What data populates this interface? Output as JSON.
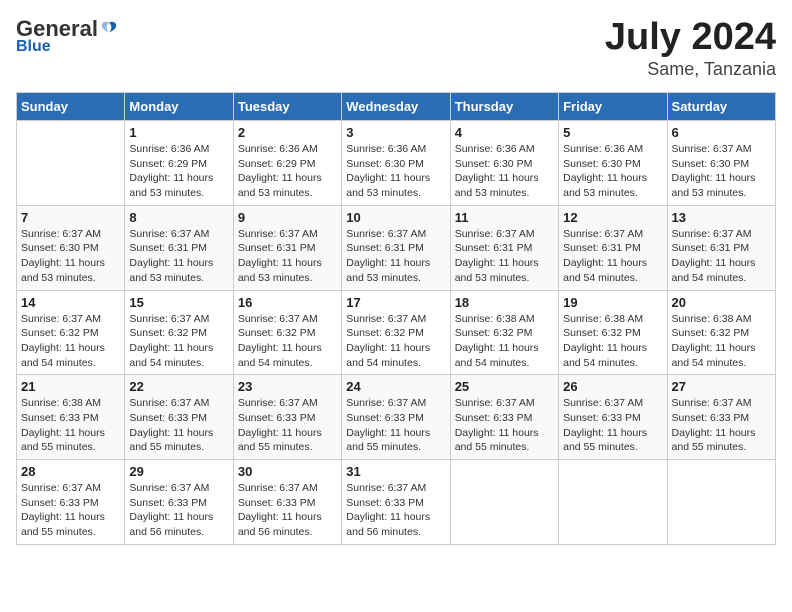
{
  "header": {
    "logo_general": "General",
    "logo_blue": "Blue",
    "title": "July 2024",
    "location": "Same, Tanzania"
  },
  "days_of_week": [
    "Sunday",
    "Monday",
    "Tuesday",
    "Wednesday",
    "Thursday",
    "Friday",
    "Saturday"
  ],
  "weeks": [
    [
      {
        "day": "",
        "sunrise": "",
        "sunset": "",
        "daylight": ""
      },
      {
        "day": "1",
        "sunrise": "Sunrise: 6:36 AM",
        "sunset": "Sunset: 6:29 PM",
        "daylight": "Daylight: 11 hours and 53 minutes."
      },
      {
        "day": "2",
        "sunrise": "Sunrise: 6:36 AM",
        "sunset": "Sunset: 6:29 PM",
        "daylight": "Daylight: 11 hours and 53 minutes."
      },
      {
        "day": "3",
        "sunrise": "Sunrise: 6:36 AM",
        "sunset": "Sunset: 6:30 PM",
        "daylight": "Daylight: 11 hours and 53 minutes."
      },
      {
        "day": "4",
        "sunrise": "Sunrise: 6:36 AM",
        "sunset": "Sunset: 6:30 PM",
        "daylight": "Daylight: 11 hours and 53 minutes."
      },
      {
        "day": "5",
        "sunrise": "Sunrise: 6:36 AM",
        "sunset": "Sunset: 6:30 PM",
        "daylight": "Daylight: 11 hours and 53 minutes."
      },
      {
        "day": "6",
        "sunrise": "Sunrise: 6:37 AM",
        "sunset": "Sunset: 6:30 PM",
        "daylight": "Daylight: 11 hours and 53 minutes."
      }
    ],
    [
      {
        "day": "7",
        "sunrise": "Sunrise: 6:37 AM",
        "sunset": "Sunset: 6:30 PM",
        "daylight": "Daylight: 11 hours and 53 minutes."
      },
      {
        "day": "8",
        "sunrise": "Sunrise: 6:37 AM",
        "sunset": "Sunset: 6:31 PM",
        "daylight": "Daylight: 11 hours and 53 minutes."
      },
      {
        "day": "9",
        "sunrise": "Sunrise: 6:37 AM",
        "sunset": "Sunset: 6:31 PM",
        "daylight": "Daylight: 11 hours and 53 minutes."
      },
      {
        "day": "10",
        "sunrise": "Sunrise: 6:37 AM",
        "sunset": "Sunset: 6:31 PM",
        "daylight": "Daylight: 11 hours and 53 minutes."
      },
      {
        "day": "11",
        "sunrise": "Sunrise: 6:37 AM",
        "sunset": "Sunset: 6:31 PM",
        "daylight": "Daylight: 11 hours and 53 minutes."
      },
      {
        "day": "12",
        "sunrise": "Sunrise: 6:37 AM",
        "sunset": "Sunset: 6:31 PM",
        "daylight": "Daylight: 11 hours and 54 minutes."
      },
      {
        "day": "13",
        "sunrise": "Sunrise: 6:37 AM",
        "sunset": "Sunset: 6:31 PM",
        "daylight": "Daylight: 11 hours and 54 minutes."
      }
    ],
    [
      {
        "day": "14",
        "sunrise": "Sunrise: 6:37 AM",
        "sunset": "Sunset: 6:32 PM",
        "daylight": "Daylight: 11 hours and 54 minutes."
      },
      {
        "day": "15",
        "sunrise": "Sunrise: 6:37 AM",
        "sunset": "Sunset: 6:32 PM",
        "daylight": "Daylight: 11 hours and 54 minutes."
      },
      {
        "day": "16",
        "sunrise": "Sunrise: 6:37 AM",
        "sunset": "Sunset: 6:32 PM",
        "daylight": "Daylight: 11 hours and 54 minutes."
      },
      {
        "day": "17",
        "sunrise": "Sunrise: 6:37 AM",
        "sunset": "Sunset: 6:32 PM",
        "daylight": "Daylight: 11 hours and 54 minutes."
      },
      {
        "day": "18",
        "sunrise": "Sunrise: 6:38 AM",
        "sunset": "Sunset: 6:32 PM",
        "daylight": "Daylight: 11 hours and 54 minutes."
      },
      {
        "day": "19",
        "sunrise": "Sunrise: 6:38 AM",
        "sunset": "Sunset: 6:32 PM",
        "daylight": "Daylight: 11 hours and 54 minutes."
      },
      {
        "day": "20",
        "sunrise": "Sunrise: 6:38 AM",
        "sunset": "Sunset: 6:32 PM",
        "daylight": "Daylight: 11 hours and 54 minutes."
      }
    ],
    [
      {
        "day": "21",
        "sunrise": "Sunrise: 6:38 AM",
        "sunset": "Sunset: 6:33 PM",
        "daylight": "Daylight: 11 hours and 55 minutes."
      },
      {
        "day": "22",
        "sunrise": "Sunrise: 6:37 AM",
        "sunset": "Sunset: 6:33 PM",
        "daylight": "Daylight: 11 hours and 55 minutes."
      },
      {
        "day": "23",
        "sunrise": "Sunrise: 6:37 AM",
        "sunset": "Sunset: 6:33 PM",
        "daylight": "Daylight: 11 hours and 55 minutes."
      },
      {
        "day": "24",
        "sunrise": "Sunrise: 6:37 AM",
        "sunset": "Sunset: 6:33 PM",
        "daylight": "Daylight: 11 hours and 55 minutes."
      },
      {
        "day": "25",
        "sunrise": "Sunrise: 6:37 AM",
        "sunset": "Sunset: 6:33 PM",
        "daylight": "Daylight: 11 hours and 55 minutes."
      },
      {
        "day": "26",
        "sunrise": "Sunrise: 6:37 AM",
        "sunset": "Sunset: 6:33 PM",
        "daylight": "Daylight: 11 hours and 55 minutes."
      },
      {
        "day": "27",
        "sunrise": "Sunrise: 6:37 AM",
        "sunset": "Sunset: 6:33 PM",
        "daylight": "Daylight: 11 hours and 55 minutes."
      }
    ],
    [
      {
        "day": "28",
        "sunrise": "Sunrise: 6:37 AM",
        "sunset": "Sunset: 6:33 PM",
        "daylight": "Daylight: 11 hours and 55 minutes."
      },
      {
        "day": "29",
        "sunrise": "Sunrise: 6:37 AM",
        "sunset": "Sunset: 6:33 PM",
        "daylight": "Daylight: 11 hours and 56 minutes."
      },
      {
        "day": "30",
        "sunrise": "Sunrise: 6:37 AM",
        "sunset": "Sunset: 6:33 PM",
        "daylight": "Daylight: 11 hours and 56 minutes."
      },
      {
        "day": "31",
        "sunrise": "Sunrise: 6:37 AM",
        "sunset": "Sunset: 6:33 PM",
        "daylight": "Daylight: 11 hours and 56 minutes."
      },
      {
        "day": "",
        "sunrise": "",
        "sunset": "",
        "daylight": ""
      },
      {
        "day": "",
        "sunrise": "",
        "sunset": "",
        "daylight": ""
      },
      {
        "day": "",
        "sunrise": "",
        "sunset": "",
        "daylight": ""
      }
    ]
  ]
}
